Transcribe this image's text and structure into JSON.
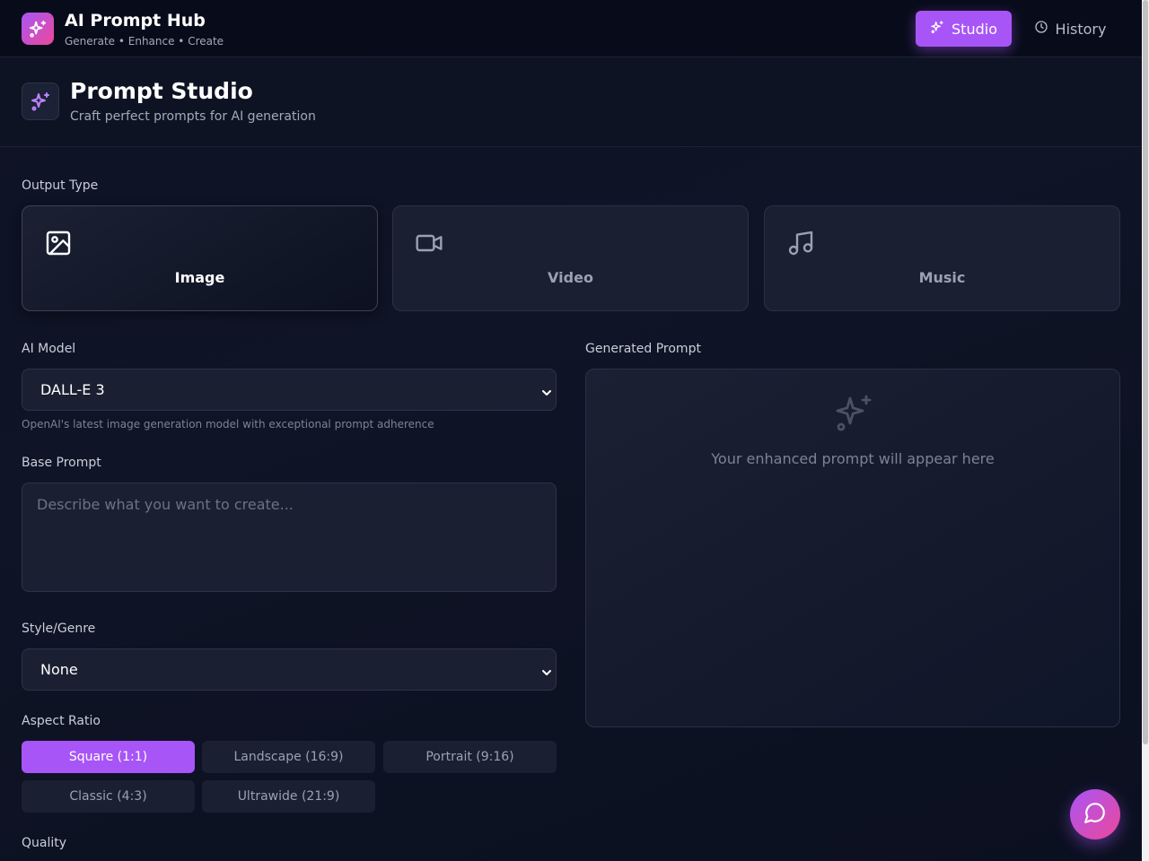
{
  "app": {
    "title": "AI Prompt Hub",
    "subtitle": "Generate • Enhance • Create"
  },
  "nav": {
    "studio_label": "Studio",
    "history_label": "History"
  },
  "page": {
    "title": "Prompt Studio",
    "subtitle": "Craft perfect prompts for AI generation"
  },
  "output_type": {
    "label": "Output Type",
    "options": [
      {
        "label": "Image",
        "icon": "image-icon",
        "selected": true
      },
      {
        "label": "Video",
        "icon": "video-icon",
        "selected": false
      },
      {
        "label": "Music",
        "icon": "music-icon",
        "selected": false
      }
    ]
  },
  "model": {
    "label": "AI Model",
    "value": "DALL-E 3",
    "hint": "OpenAI's latest image generation model with exceptional prompt adherence"
  },
  "base_prompt": {
    "label": "Base Prompt",
    "placeholder": "Describe what you want to create..."
  },
  "style": {
    "label": "Style/Genre",
    "value": "None"
  },
  "aspect_ratio": {
    "label": "Aspect Ratio",
    "options": [
      "Square (1:1)",
      "Landscape (16:9)",
      "Portrait (9:16)",
      "Classic (4:3)",
      "Ultrawide (21:9)"
    ],
    "selected": "Square (1:1)"
  },
  "quality": {
    "label": "Quality"
  },
  "generated": {
    "label": "Generated Prompt",
    "placeholder": "Your enhanced prompt will appear here"
  },
  "colors": {
    "accent": "#a855f7",
    "accent_pink": "#ec4899",
    "background": "#0d1224",
    "panel": "#1a2032"
  }
}
